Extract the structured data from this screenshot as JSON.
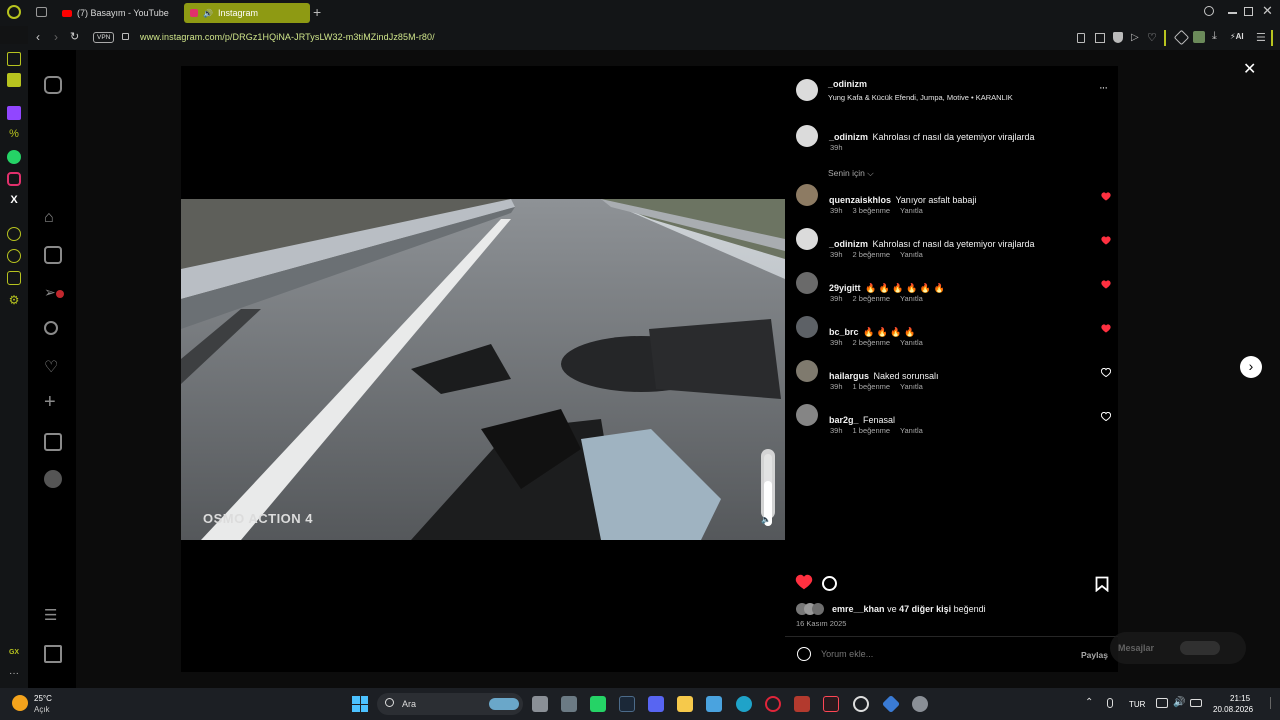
{
  "browser": {
    "tabs": [
      {
        "label": "(7) Basayım - YouTube",
        "active": false
      },
      {
        "label": "Instagram",
        "active": true
      }
    ],
    "url": "www.instagram.com/p/DRGz1HQiNA-JRTysLW32-m3tiMZindJz85M-r80/",
    "vpn_label": "VPN",
    "ai_label": "AI",
    "accent": "#b7c31f"
  },
  "video": {
    "watermark": "OSMO ACTION 4"
  },
  "post": {
    "author": "_odinizm",
    "audio": "Yung Kafa & Kücük Efendi, Jumpa, Motive • KARANLIK",
    "caption": {
      "user": "_odinizm",
      "text": "Kahrolası cf nasıl da yetemiyor virajlarda",
      "time": "39h"
    },
    "for_you": "Senin için",
    "comments": [
      {
        "user": "quenzaiskhlos",
        "text": "Yanıyor asfalt babaji",
        "time": "39h",
        "likes": "3 beğenme",
        "reply": "Yanıtla",
        "liked": true
      },
      {
        "user": "_odinizm",
        "text": "Kahrolası cf nasıl da yetemiyor virajlarda",
        "time": "39h",
        "likes": "2 beğenme",
        "reply": "Yanıtla",
        "liked": true
      },
      {
        "user": "29yigitt",
        "text": "🔥 🔥 🔥 🔥 🔥 🔥",
        "time": "39h",
        "likes": "2 beğenme",
        "reply": "Yanıtla",
        "liked": true
      },
      {
        "user": "bc_brc",
        "text": "🔥 🔥 🔥 🔥",
        "time": "39h",
        "likes": "2 beğenme",
        "reply": "Yanıtla",
        "liked": true
      },
      {
        "user": "hailargus",
        "text": "Naked sorunsalı",
        "time": "39h",
        "likes": "1 beğenme",
        "reply": "Yanıtla",
        "liked": false
      },
      {
        "user": "bar2g_",
        "text": "Fenasal",
        "time": "39h",
        "likes": "1 beğenme",
        "reply": "Yanıtla",
        "liked": false
      }
    ],
    "liked_by_user": "emre__khan",
    "liked_by_connector": "ve",
    "liked_by_others": "47 diğer kişi",
    "liked_by_suffix": "beğendi",
    "date": "16 Kasım 2025",
    "comment_placeholder": "Yorum ekle...",
    "share_label": "Paylaş"
  },
  "messages_label": "Mesajlar",
  "taskbar": {
    "weather_temp": "25°C",
    "weather_desc": "Açık",
    "search_label": "Ara",
    "lang": "TUR",
    "time": "21:15",
    "date": "20.08.2026"
  },
  "colors": {
    "like_red": "#ff3040"
  }
}
